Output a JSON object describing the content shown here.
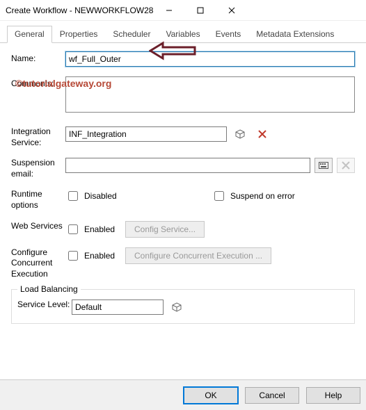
{
  "window": {
    "title": "Create Workflow - NEWWORKFLOW28"
  },
  "tabs": {
    "general": "General",
    "properties": "Properties",
    "scheduler": "Scheduler",
    "variables": "Variables",
    "events": "Events",
    "metadata": "Metadata Extensions"
  },
  "labels": {
    "name": "Name:",
    "comments": "Comments:",
    "integration": "Integration Service:",
    "suspension": "Suspension email:",
    "runtime": "Runtime options",
    "webservices": "Web Services",
    "concurrent": "Configure Concurrent Execution",
    "loadbalancing": "Load Balancing",
    "servicelevel": "Service Level:"
  },
  "fields": {
    "name_value": "wf_Full_Outer",
    "comments_value": "",
    "integration_value": "INF_Integration",
    "suspension_value": "",
    "servicelevel_value": "Default"
  },
  "checkboxes": {
    "disabled": "Disabled",
    "suspend_on_error": "Suspend on error",
    "ws_enabled": "Enabled",
    "cc_enabled": "Enabled"
  },
  "buttons": {
    "config_service": "Config Service...",
    "config_concurrent": "Configure Concurrent Execution ...",
    "ok": "OK",
    "cancel": "Cancel",
    "help": "Help"
  },
  "watermark": "©tutorialgateway.org"
}
